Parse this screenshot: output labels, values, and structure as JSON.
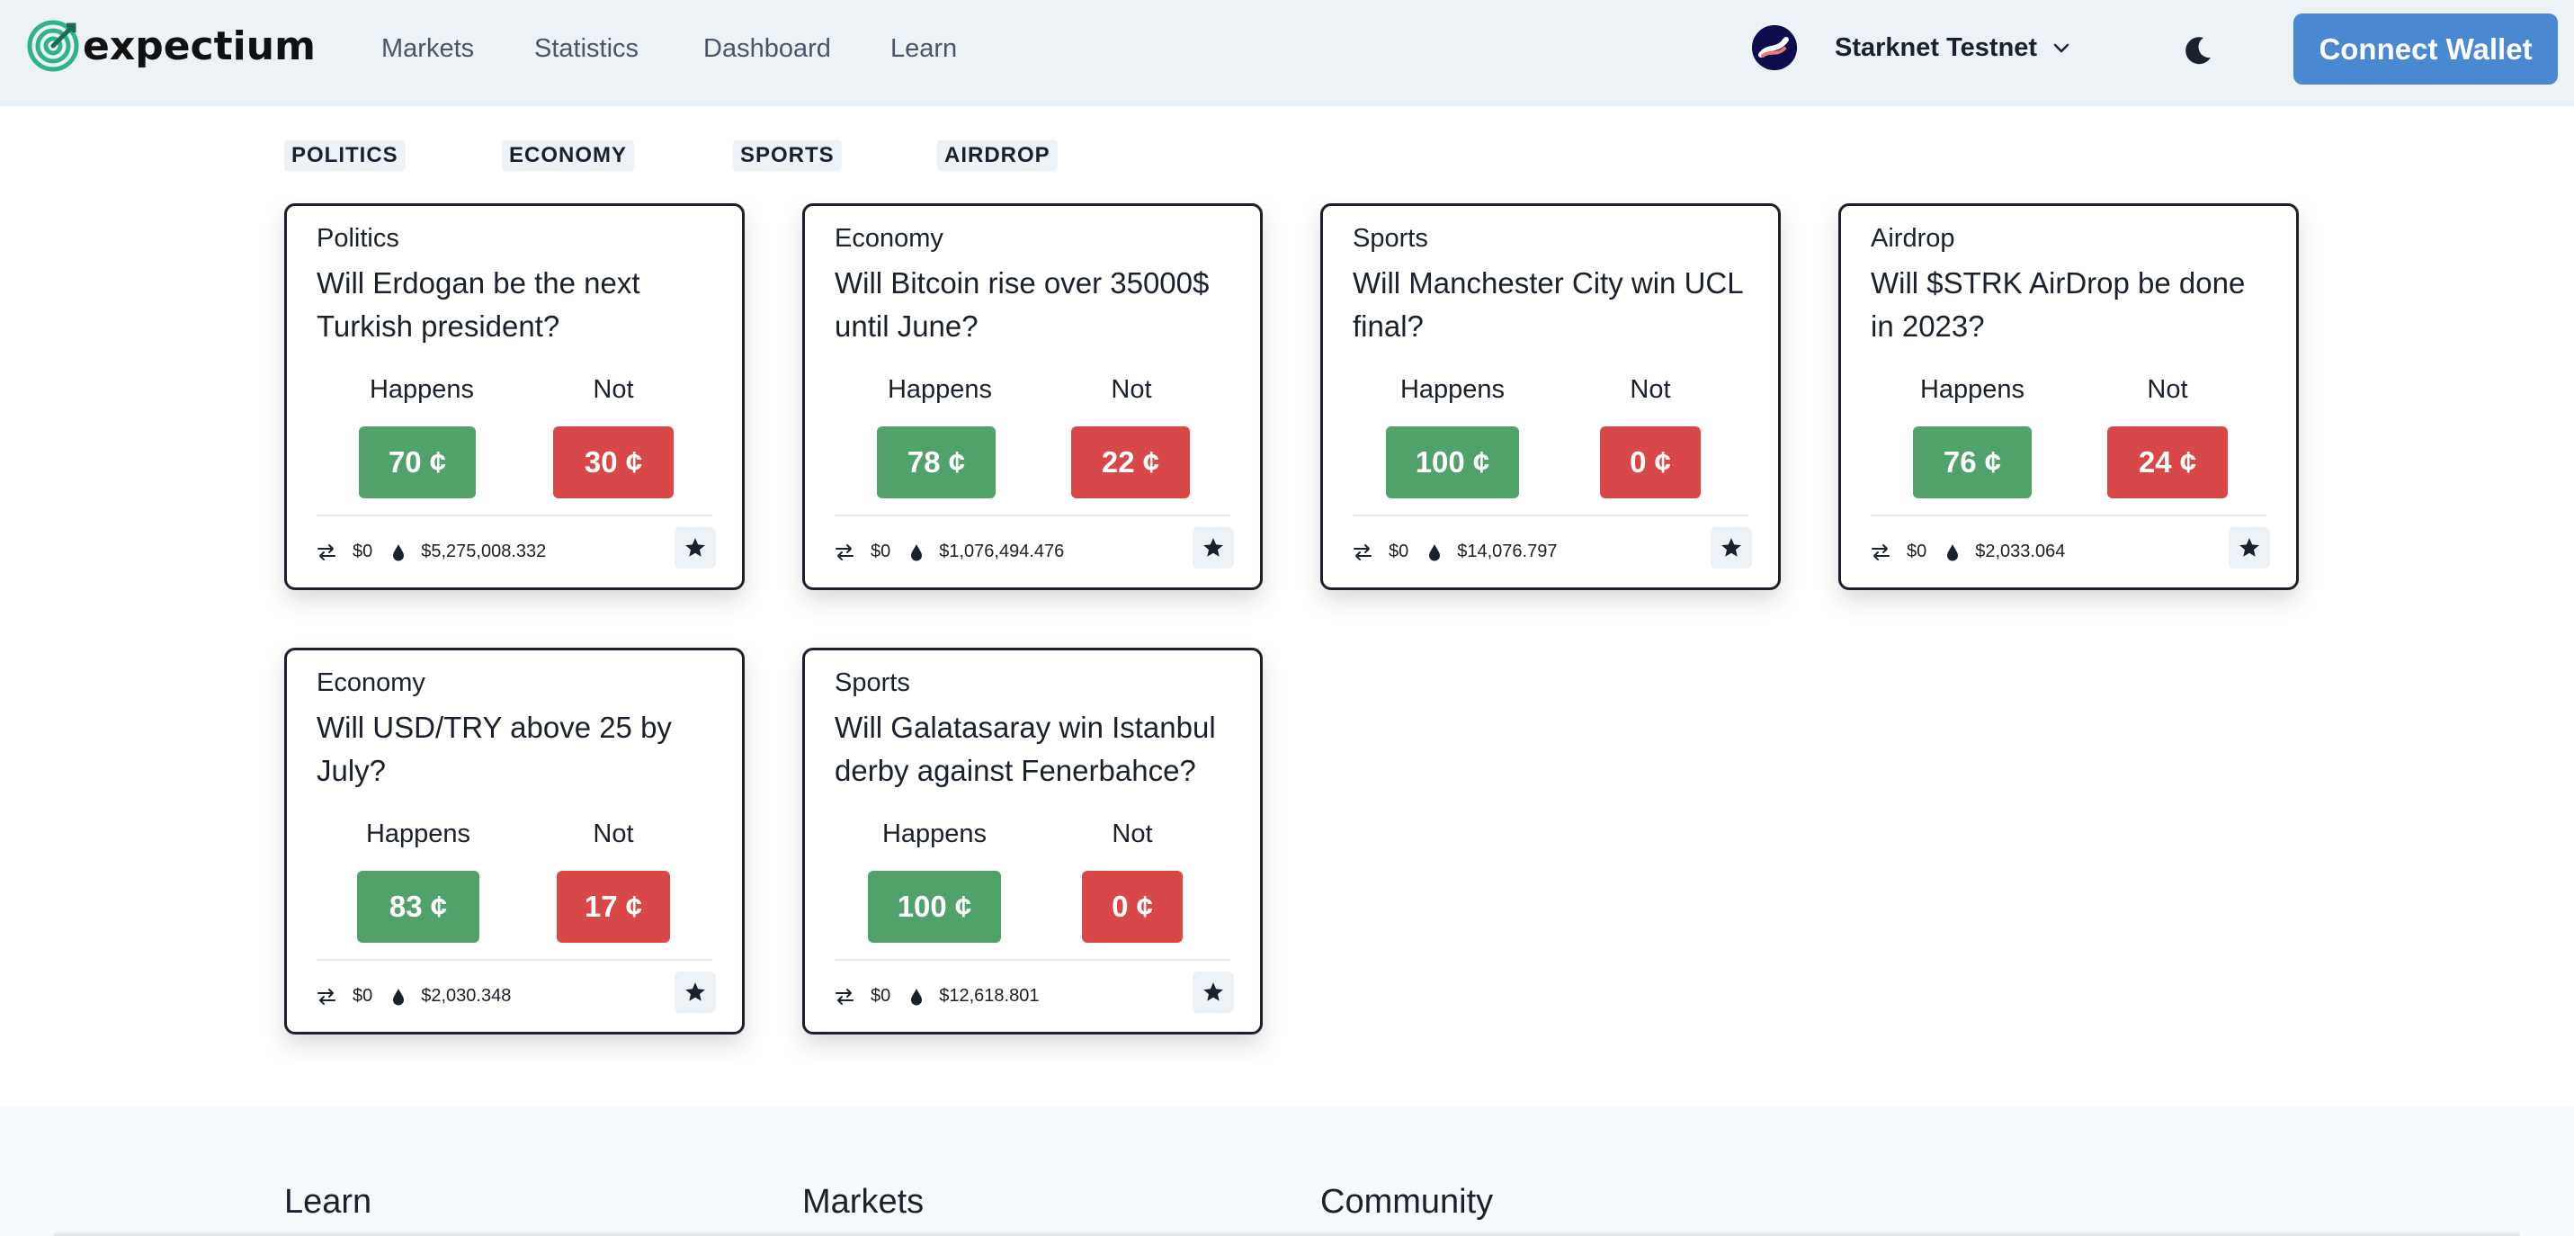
{
  "header": {
    "logo_text": "expectium",
    "nav": [
      "Markets",
      "Statistics",
      "Dashboard",
      "Learn"
    ],
    "network_label": "Starknet Testnet",
    "connect_label": "Connect Wallet"
  },
  "categories": [
    "POLITICS",
    "ECONOMY",
    "SPORTS",
    "AIRDROP"
  ],
  "markets": [
    {
      "category": "Politics",
      "question": "Will Erdogan be the next Turkish president?",
      "happens_label": "Happens",
      "not_label": "Not",
      "happens_price": "70 ¢",
      "not_price": "30 ¢",
      "volume": "$0",
      "liquidity": "$5,275,008.332"
    },
    {
      "category": "Economy",
      "question": "Will Bitcoin rise over 35000$ until June?",
      "happens_label": "Happens",
      "not_label": "Not",
      "happens_price": "78 ¢",
      "not_price": "22 ¢",
      "volume": "$0",
      "liquidity": "$1,076,494.476"
    },
    {
      "category": "Sports",
      "question": "Will Manchester City win UCL final?",
      "happens_label": "Happens",
      "not_label": "Not",
      "happens_price": "100 ¢",
      "not_price": "0 ¢",
      "volume": "$0",
      "liquidity": "$14,076.797"
    },
    {
      "category": "Airdrop",
      "question": "Will $STRK AirDrop be done in 2023?",
      "happens_label": "Happens",
      "not_label": "Not",
      "happens_price": "76 ¢",
      "not_price": "24 ¢",
      "volume": "$0",
      "liquidity": "$2,033.064"
    },
    {
      "category": "Economy",
      "question": "Will USD/TRY above 25 by July?",
      "happens_label": "Happens",
      "not_label": "Not",
      "happens_price": "83 ¢",
      "not_price": "17 ¢",
      "volume": "$0",
      "liquidity": "$2,030.348"
    },
    {
      "category": "Sports",
      "question": "Will Galatasaray win Istanbul derby against Fenerbahce?",
      "happens_label": "Happens",
      "not_label": "Not",
      "happens_price": "100 ¢",
      "not_price": "0 ¢",
      "volume": "$0",
      "liquidity": "$12,618.801"
    }
  ],
  "footer": {
    "headings": [
      "Learn",
      "Markets",
      "Community"
    ]
  },
  "colors": {
    "accent": "#4a88d1",
    "happens": "#51a26a",
    "not": "#d94848",
    "header_bg": "#edf2f7"
  },
  "icons": {
    "logo": "target-logo-icon",
    "network": "starknet-icon",
    "dropdown": "chevron-down-icon",
    "theme": "moon-icon",
    "volume": "swap-arrows-icon",
    "liquidity": "droplet-icon",
    "favorite": "star-icon"
  }
}
